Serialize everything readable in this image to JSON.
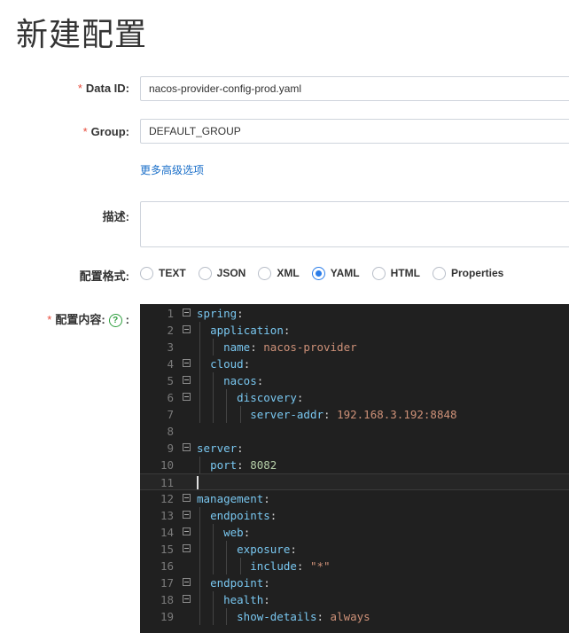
{
  "page": {
    "title": "新建配置"
  },
  "form": {
    "data_id": {
      "label": "Data ID:",
      "value": "nacos-provider-config-prod.yaml"
    },
    "group": {
      "label": "Group:",
      "value": "DEFAULT_GROUP"
    },
    "advanced_link": "更多高级选项",
    "description": {
      "label": "描述:",
      "value": ""
    },
    "format": {
      "label": "配置格式:",
      "options": [
        "TEXT",
        "JSON",
        "XML",
        "YAML",
        "HTML",
        "Properties"
      ],
      "selected": "YAML"
    },
    "content": {
      "label": "配置内容:",
      "colon": ":"
    }
  },
  "editor": {
    "lines": [
      {
        "n": "1",
        "text": "spring:"
      },
      {
        "n": "2",
        "text": "  application:"
      },
      {
        "n": "3",
        "text": "    name: nacos-provider"
      },
      {
        "n": "4",
        "text": "  cloud:"
      },
      {
        "n": "5",
        "text": "    nacos:"
      },
      {
        "n": "6",
        "text": "      discovery:"
      },
      {
        "n": "7",
        "text": "        server-addr: 192.168.3.192:8848"
      },
      {
        "n": "8",
        "text": ""
      },
      {
        "n": "9",
        "text": "server:"
      },
      {
        "n": "10",
        "text": "  port: 8082"
      },
      {
        "n": "11",
        "text": ""
      },
      {
        "n": "12",
        "text": "management:"
      },
      {
        "n": "13",
        "text": "  endpoints:"
      },
      {
        "n": "14",
        "text": "    web:"
      },
      {
        "n": "15",
        "text": "      exposure:"
      },
      {
        "n": "16",
        "text": "        include: \"*\""
      },
      {
        "n": "17",
        "text": "  endpoint:"
      },
      {
        "n": "18",
        "text": "    health:"
      },
      {
        "n": "19",
        "text": "      show-details: always"
      }
    ],
    "foldable_lines": [
      "1",
      "2",
      "4",
      "5",
      "6",
      "9",
      "12",
      "13",
      "14",
      "15",
      "17",
      "18"
    ],
    "active_line": "11"
  },
  "colors": {
    "accent": "#2b7de9",
    "required": "#e74c3c",
    "editor_bg": "#202020",
    "link": "#1a6fc9"
  }
}
